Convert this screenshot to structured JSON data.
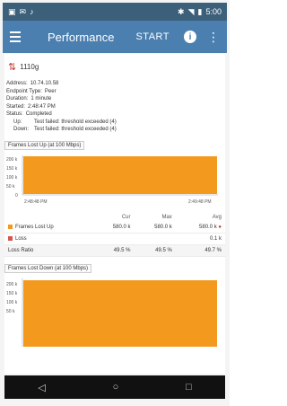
{
  "status_bar": {
    "left_icons": [
      "image-icon",
      "message-icon",
      "bell-icon"
    ],
    "right_text": "5:00"
  },
  "app_bar": {
    "title": "Performance",
    "start_label": "START",
    "info_label": "i",
    "more_label": "⋮"
  },
  "test": {
    "title": "1110g",
    "rows": [
      {
        "key": "Address:",
        "value": "10.74.10.58"
      },
      {
        "key": "Endpoint Type:",
        "value": "Peer"
      },
      {
        "key": "Duration:",
        "value": "1 minute"
      },
      {
        "key": "Started:",
        "value": "2:48:47 PM"
      },
      {
        "key": "Status:",
        "value": "Completed"
      },
      {
        "key": "Up:",
        "value": "Test failed: threshold exceeded (4)",
        "indent": true
      },
      {
        "key": "Down:",
        "value": "Test failed: threshold exceeded (4)",
        "indent": true
      }
    ]
  },
  "chart_up": {
    "label": "Frames Lost Up (at 100 Mbps)",
    "y_ticks": [
      "200 k",
      "150 k",
      "100 k",
      "50 k",
      "0"
    ],
    "x_ticks": [
      "2:48:48 PM",
      "2:49:48 PM"
    ],
    "fill_color": "#f39a1e"
  },
  "stats": {
    "headers": [
      "",
      "Cur",
      "Max",
      "Avg"
    ],
    "rows": [
      {
        "label": "Frames Lost Up",
        "cur": "580.0 k",
        "max": "580.0 k",
        "avg": "580.0 k",
        "swatch": "frames",
        "marker": "●"
      },
      {
        "label": "Loss",
        "cur": "",
        "max": "",
        "avg": "0.1 k",
        "swatch": "loss",
        "marker": ""
      },
      {
        "label": "Loss Ratio",
        "cur": "49.5 %",
        "max": "49.5 %",
        "avg": "49.7 %",
        "swatch": "",
        "marker": ""
      }
    ]
  },
  "chart_down": {
    "label": "Frames Lost Down (at 100 Mbps)",
    "y_ticks": [
      "200 k",
      "150 k",
      "100 k",
      "50 k"
    ],
    "fill_color": "#f39a1e"
  },
  "nav": {
    "back": "◁",
    "home": "○",
    "recents": "□"
  }
}
